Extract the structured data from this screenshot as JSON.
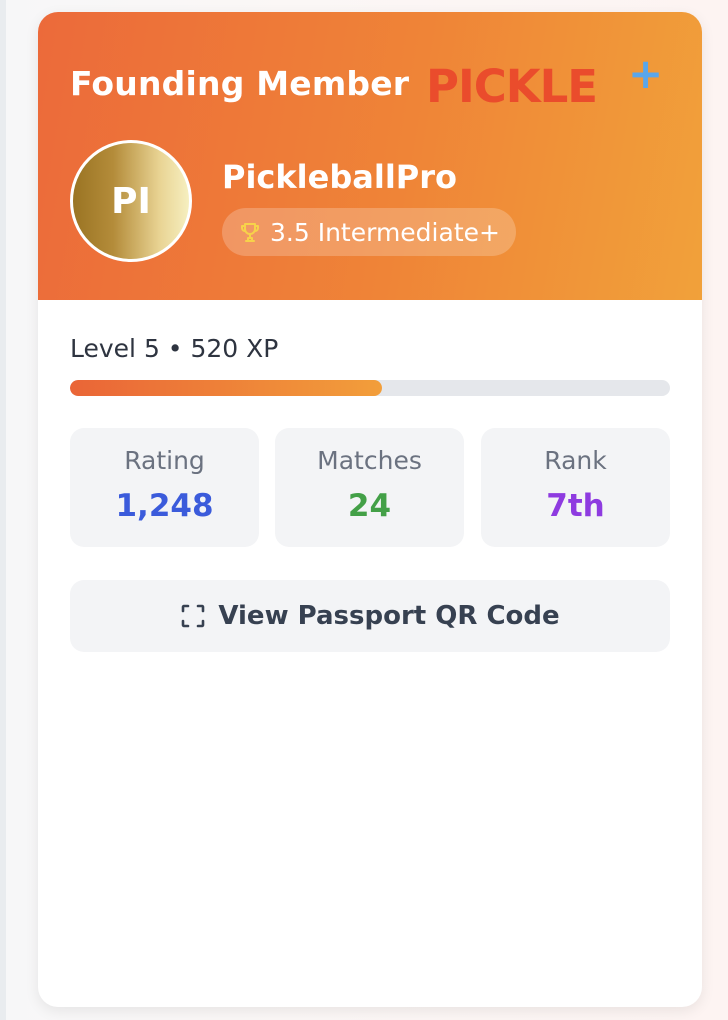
{
  "card": {
    "membership_label": "Founding Member",
    "brand": {
      "word": "PICKLE",
      "plus": "+",
      "word_color": "#ea4c2c",
      "plus_color": "#5aa6ea"
    },
    "header_gradient": [
      "#ec6a3a",
      "#f1a13a"
    ]
  },
  "profile": {
    "initials": "PI",
    "username": "PickleballPro",
    "skill_icon": "trophy-icon",
    "skill_label": "3.5 Intermediate+"
  },
  "progress": {
    "level_text": "Level 5 • 520 XP",
    "xp_progress_fraction": 0.52
  },
  "stats": [
    {
      "label": "Rating",
      "value": "1,248",
      "color": "#3b5bdb"
    },
    {
      "label": "Matches",
      "value": "24",
      "color": "#43a047"
    },
    {
      "label": "Rank",
      "value": "7th",
      "color": "#8e3be0"
    }
  ],
  "actions": {
    "qr_icon": "scan-icon",
    "qr_button_label": "View Passport QR Code"
  }
}
